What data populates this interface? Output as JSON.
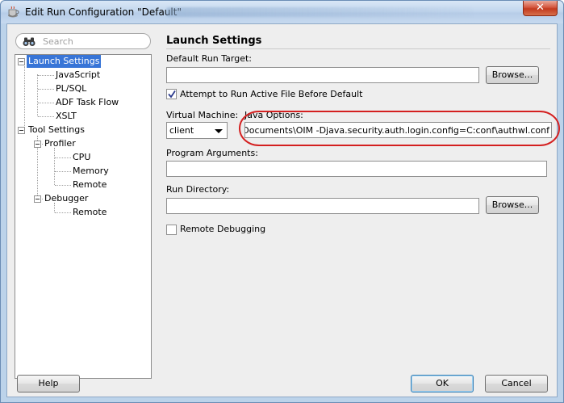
{
  "window": {
    "title": "Edit Run Configuration \"Default\"",
    "close_label": "✕"
  },
  "search": {
    "placeholder": "Search"
  },
  "tree": {
    "launch_settings": "Launch Settings",
    "javascript": "JavaScript",
    "plsql": "PL/SQL",
    "adf_task_flow": "ADF Task Flow",
    "xslt": "XSLT",
    "tool_settings": "Tool Settings",
    "profiler": "Profiler",
    "cpu": "CPU",
    "memory": "Memory",
    "profiler_remote": "Remote",
    "debugger": "Debugger",
    "debugger_remote": "Remote"
  },
  "panel": {
    "title": "Launch Settings",
    "default_run_target_label": "Default Run Target:",
    "default_run_target_value": "",
    "browse_label": "Browse...",
    "attempt_label": "Attempt to Run Active File Before Default",
    "attempt_checked": true,
    "virtual_machine_label": "Virtual Machine:",
    "virtual_machine_value": "client",
    "java_options_label": "Java Options:",
    "java_options_value": "ersonal\\Documents\\OIM -Djava.security.auth.login.config=C:conf\\authwl.conf",
    "program_arguments_label": "Program Arguments:",
    "program_arguments_value": "",
    "run_directory_label": "Run Directory:",
    "run_directory_value": "",
    "browse2_label": "Browse...",
    "remote_debugging_label": "Remote Debugging",
    "remote_debugging_checked": false
  },
  "footer": {
    "help_label": "Help",
    "ok_label": "OK",
    "cancel_label": "Cancel"
  },
  "colors": {
    "selection": "#3875d7",
    "annotation_ellipse": "#d42020",
    "close_button": "#c23a1e"
  }
}
